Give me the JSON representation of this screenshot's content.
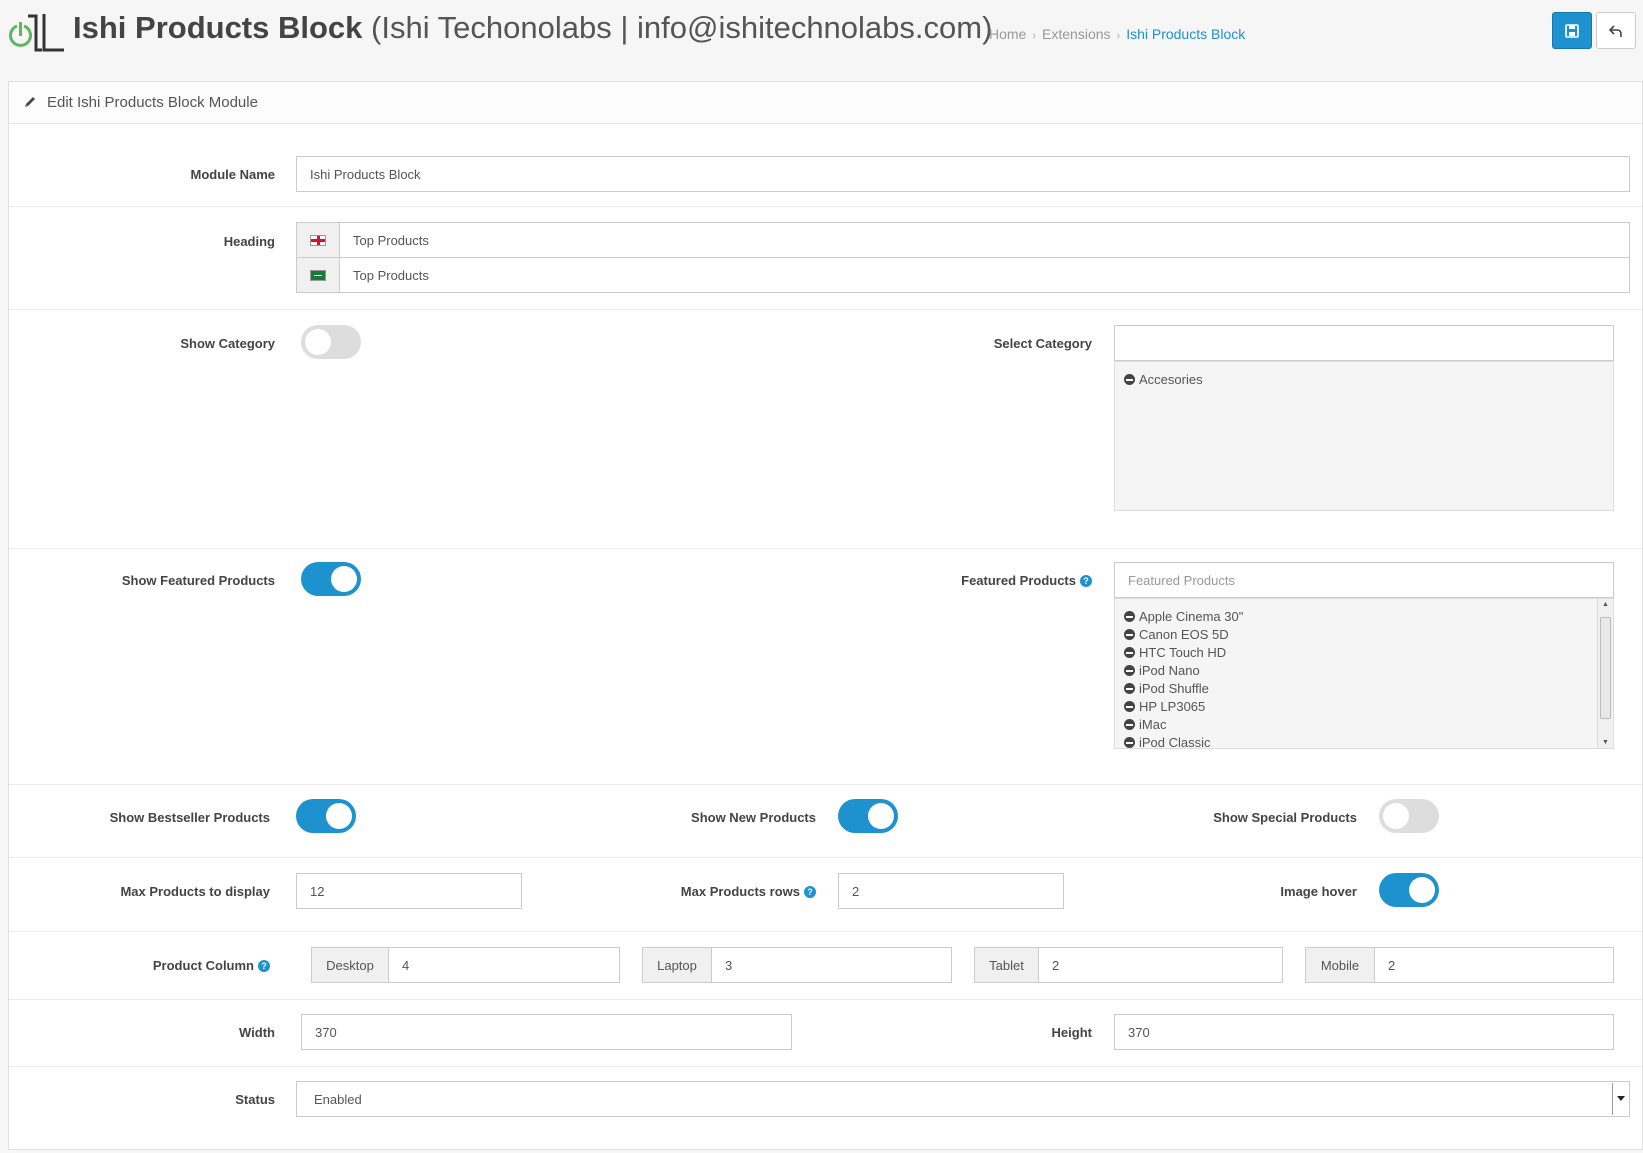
{
  "header": {
    "title_bold": "Ishi Products Block",
    "title_sub": "(Ishi Techonolabs | info@ishitechnolabs.com)",
    "breadcrumb": [
      "Home",
      "Extensions",
      "Ishi Products Block"
    ],
    "save_icon": "floppy-icon",
    "back_icon": "reply-icon"
  },
  "panel": {
    "title": "Edit Ishi Products Block Module"
  },
  "form": {
    "module_name": {
      "label": "Module Name",
      "value": "Ishi Products Block"
    },
    "heading": {
      "label": "Heading",
      "values": [
        "Top Products",
        "Top Products"
      ]
    },
    "show_category": {
      "label": "Show Category",
      "on": false
    },
    "select_category": {
      "label": "Select Category",
      "value": "",
      "items": [
        "Accesories"
      ]
    },
    "show_featured": {
      "label": "Show Featured Products",
      "on": true
    },
    "featured_products": {
      "label": "Featured Products",
      "placeholder": "Featured Products",
      "items": [
        "Apple Cinema 30\"",
        "Canon EOS 5D",
        "HTC Touch HD",
        "iPod Nano",
        "iPod Shuffle",
        "HP LP3065",
        "iMac",
        "iPod Classic"
      ]
    },
    "show_bestseller": {
      "label": "Show Bestseller Products",
      "on": true
    },
    "show_new": {
      "label": "Show New Products",
      "on": true
    },
    "show_special": {
      "label": "Show Special Products",
      "on": false
    },
    "max_products": {
      "label": "Max Products to display",
      "value": "12"
    },
    "max_rows": {
      "label": "Max Products rows",
      "value": "2"
    },
    "image_hover": {
      "label": "Image hover",
      "on": true
    },
    "product_column": {
      "label": "Product Column",
      "desktop_label": "Desktop",
      "desktop": "4",
      "laptop_label": "Laptop",
      "laptop": "3",
      "tablet_label": "Tablet",
      "tablet": "2",
      "mobile_label": "Mobile",
      "mobile": "2"
    },
    "width": {
      "label": "Width",
      "value": "370"
    },
    "height": {
      "label": "Height",
      "value": "370"
    },
    "status": {
      "label": "Status",
      "value": "Enabled"
    }
  },
  "colors": {
    "primary": "#1e91cf",
    "toggle_off": "#dddddd",
    "logo_green": "#4caf50"
  }
}
